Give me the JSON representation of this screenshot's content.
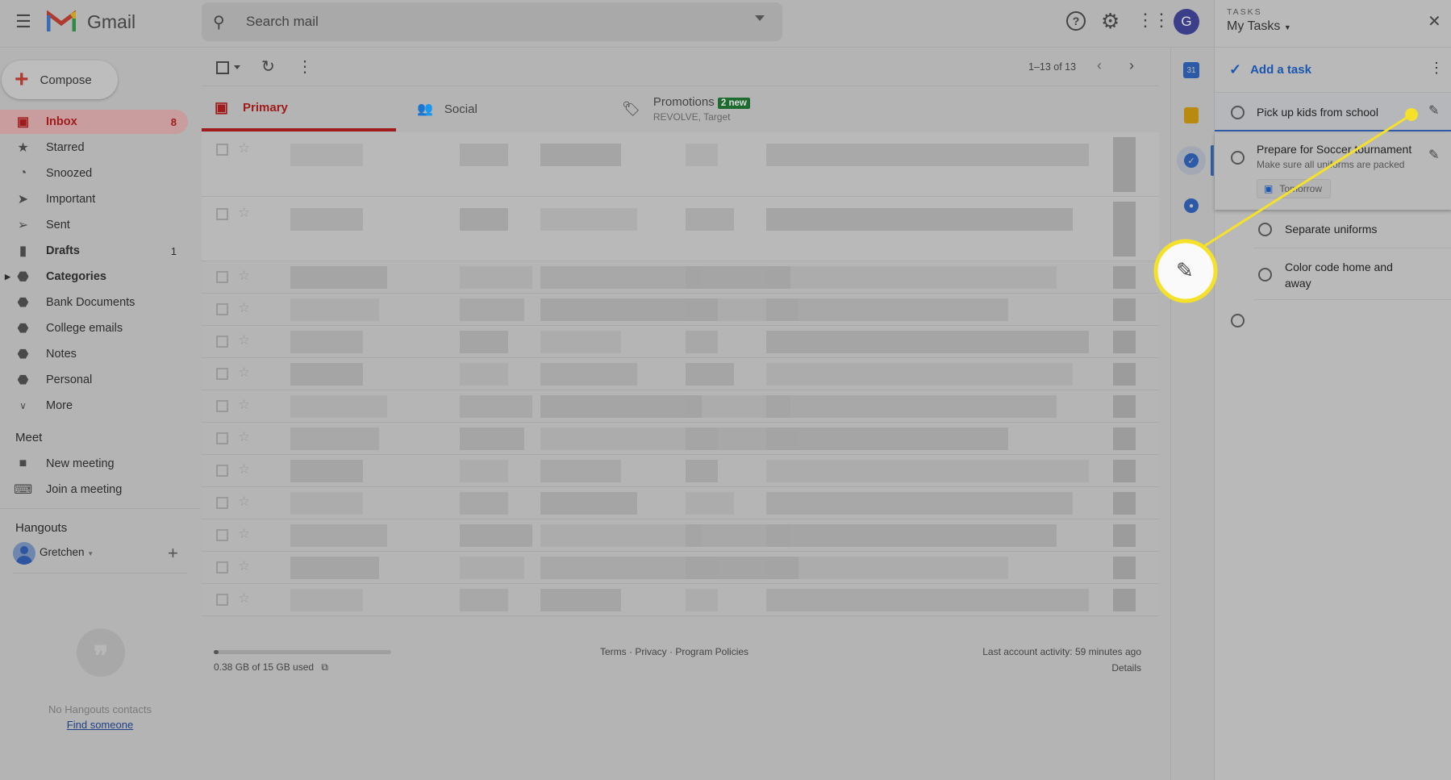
{
  "header": {
    "app_name": "Gmail",
    "search_placeholder": "Search mail",
    "avatar_letter": "G"
  },
  "compose": {
    "label": "Compose"
  },
  "sidebar": {
    "items": [
      {
        "label": "Inbox",
        "count": "8",
        "icon": "inbox-icon",
        "active": true
      },
      {
        "label": "Starred",
        "icon": "star-icon"
      },
      {
        "label": "Snoozed",
        "icon": "clock-icon"
      },
      {
        "label": "Important",
        "icon": "important-icon"
      },
      {
        "label": "Sent",
        "icon": "send-icon"
      },
      {
        "label": "Drafts",
        "count": "1",
        "icon": "draft-icon"
      },
      {
        "label": "Categories",
        "icon": "label-icon"
      },
      {
        "label": "Bank Documents",
        "icon": "label-icon"
      },
      {
        "label": "College emails",
        "icon": "label-icon"
      },
      {
        "label": "Notes",
        "icon": "label-icon"
      },
      {
        "label": "Personal",
        "icon": "label-icon"
      },
      {
        "label": "More",
        "icon": "chevron-down-icon"
      }
    ]
  },
  "meet": {
    "title": "Meet",
    "new_meeting": "New meeting",
    "join_meeting": "Join a meeting"
  },
  "hangouts": {
    "title": "Hangouts",
    "user": "Gretchen",
    "empty_text": "No Hangouts contacts",
    "find_link": "Find someone"
  },
  "toolbar": {
    "pagination": "1–13 of 13"
  },
  "tabs": [
    {
      "label": "Primary"
    },
    {
      "label": "Social"
    },
    {
      "label": "Promotions",
      "badge": "2 new",
      "subtitle": "REVOLVE, Target"
    }
  ],
  "footer": {
    "storage": "0.38 GB of 15 GB used",
    "storage_fraction": 0.025,
    "links": "Terms · Privacy · Program Policies",
    "activity": "Last account activity: 59 minutes ago",
    "details": "Details"
  },
  "tasks": {
    "header_small": "TASKS",
    "list_name": "My Tasks",
    "add_task": "Add a task",
    "items": [
      {
        "title": "Pick up kids from school"
      },
      {
        "title": "Prepare for Soccer tournament",
        "notes": "Make sure all uniforms are packed",
        "date": "Tomorrow"
      }
    ],
    "subtasks": [
      {
        "title": "Separate uniforms"
      },
      {
        "title": "Color code home and away"
      }
    ]
  },
  "colors": {
    "highlight": "#f5e12a",
    "accent": "#1a56b0",
    "inbox_red": "#a01c1c",
    "badge_green": "#1e6b2f"
  }
}
